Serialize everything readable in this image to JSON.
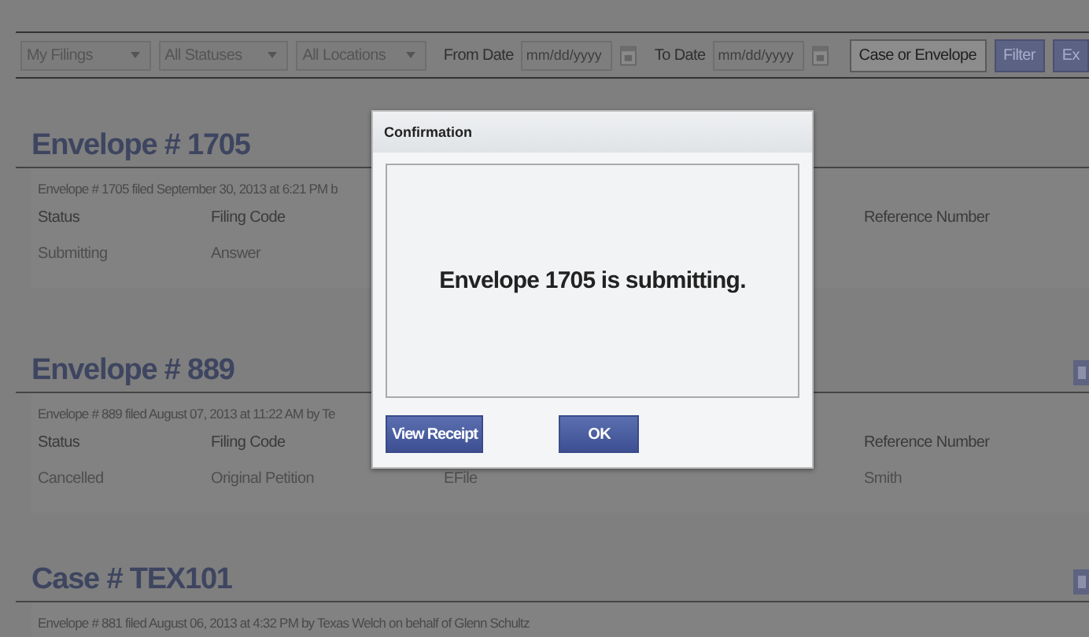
{
  "toolbar": {
    "dropdowns": [
      {
        "label": "My Filings"
      },
      {
        "label": "All Statuses"
      },
      {
        "label": "All Locations"
      }
    ],
    "from_date": {
      "label": "From Date",
      "placeholder": "mm/dd/yyyy"
    },
    "to_date": {
      "label": "To Date",
      "placeholder": "mm/dd/yyyy"
    },
    "buttons": [
      {
        "kind": "plain",
        "label": "Case or Envelope"
      },
      {
        "kind": "primary",
        "label": "Filter"
      },
      {
        "kind": "primary",
        "label": "Ex"
      }
    ]
  },
  "sections": [
    {
      "title": "Envelope # 1705",
      "subtitle": "Envelope # 1705 filed September 30, 2013 at 6:21 PM b",
      "action_icon": false,
      "columns": {
        "status": "Status",
        "filing_code": "Filing Code",
        "reference_number": "Reference Number"
      },
      "row": {
        "status": "Submitting",
        "filing_code": "Answer"
      }
    },
    {
      "title": "Envelope # 889",
      "subtitle": "Envelope # 889 filed August 07, 2013 at 11:22 AM by Te",
      "action_icon": true,
      "columns": {
        "status": "Status",
        "filing_code": "Filing Code",
        "reference_number": "Reference Number"
      },
      "row": {
        "status": "Cancelled",
        "filing_code": "Original Petition",
        "column_3": "EFile",
        "reference_number": "Smith"
      }
    },
    {
      "title": "Case # TEX101",
      "subtitle": "Envelope # 881 filed August 06, 2013 at 4:32 PM by Texas Welch on behalf of Glenn Schultz",
      "action_icon": true
    }
  ],
  "dialog": {
    "title": "Confirmation",
    "message": "Envelope 1705 is submitting.",
    "buttons": [
      {
        "kind": "receipt",
        "label": "View Receipt"
      },
      {
        "kind": "ok",
        "label": "OK"
      }
    ]
  }
}
